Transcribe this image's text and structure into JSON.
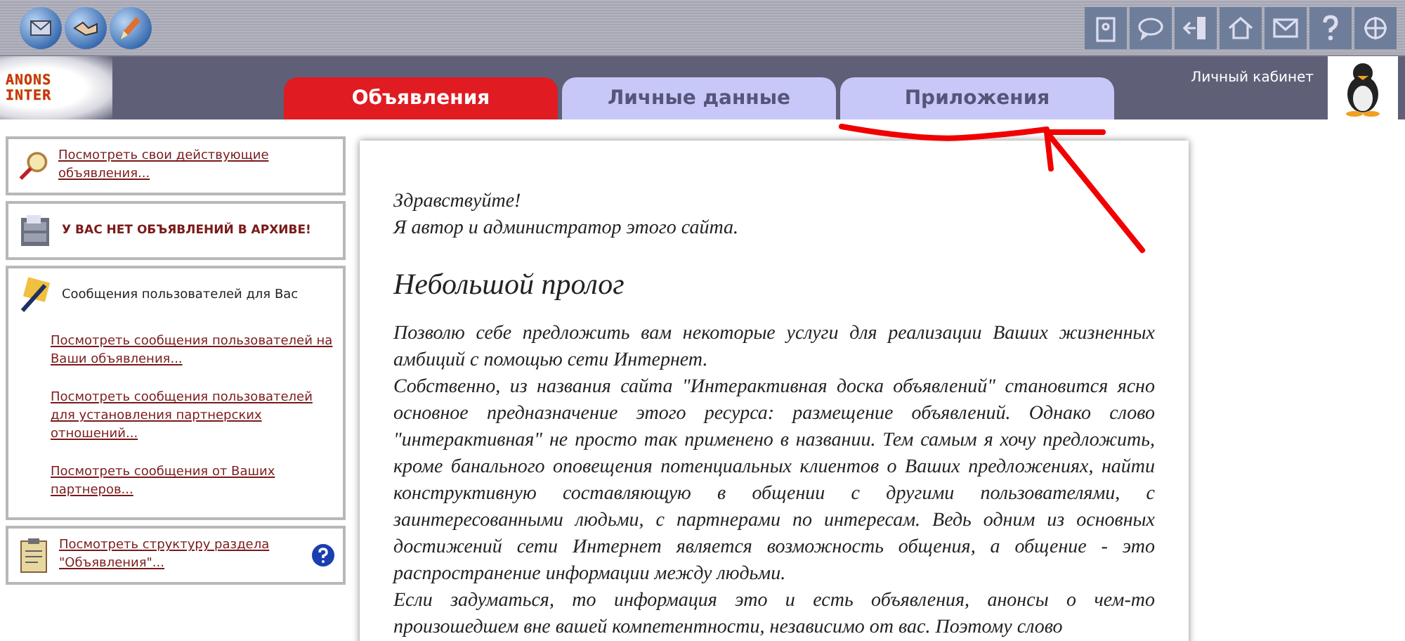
{
  "logo": {
    "line1": "ANONS",
    "line2": "INTER"
  },
  "tabs": [
    {
      "label": "Объявления",
      "selected": true
    },
    {
      "label": "Личные данные",
      "selected": false
    },
    {
      "label": "Приложения",
      "selected": false
    }
  ],
  "account": {
    "label": "Личный кабинет"
  },
  "sidebar": [
    {
      "kind": "link",
      "text": "Посмотреть свои действующие объявления..."
    },
    {
      "kind": "notice",
      "text": "У ВАС НЕТ ОБЪЯВЛЕНИЙ В АРХИВЕ!"
    },
    {
      "kind": "group",
      "title": "Сообщения пользователей для Вас",
      "links": [
        "Посмотреть сообщения пользователей на Ваши объявления...",
        "Посмотреть сообщения пользователей для установления партнерских отношений...",
        "Посмотреть сообщения от Ваших партнеров..."
      ]
    },
    {
      "kind": "help",
      "text": "Посмотреть структуру раздела \"Объявления\"..."
    }
  ],
  "article": {
    "greeting": [
      "Здравствуйте!",
      "Я автор и администратор этого сайта."
    ],
    "heading": "Небольшой пролог",
    "paragraphs": [
      "Позволю себе предложить вам некоторые услуги для реализации Ваших жизненных амбиций с помощью сети Интернет.",
      "Собственно, из названия сайта \"Интерактивная доска объявлений\" становится ясно основное предназначение этого ресурса: размещение объявлений. Однако слово \"интерактивная\" не просто так применено в названии. Тем самым я хочу предложить, кроме банального оповещения потенциальных клиентов о Ваших предложениях, найти конструктивную составляющую в общении с другими пользователями, с заинтересованными людьми, с партнерами по интересам. Ведь одним из основных достижений сети Интернет является возможность общения, а общение - это распространение информации между людьми.",
      "Если задуматься, то информация это и есть объявления, анонсы о чем-то произошедшем вне вашей компетентности, независимо от вас. Поэтому слово"
    ]
  }
}
